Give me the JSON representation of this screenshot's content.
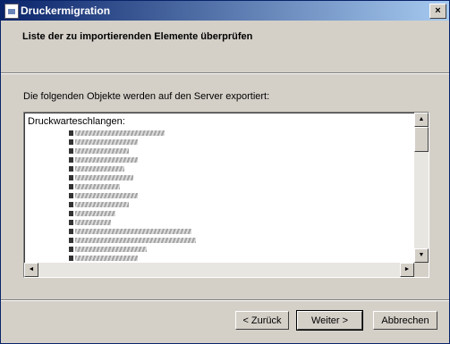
{
  "window": {
    "title": "Druckermigration",
    "close_glyph": "×"
  },
  "header": {
    "title": "Liste der zu importierenden Elemente überprüfen"
  },
  "main": {
    "intro": "Die folgenden Objekte werden auf den Server exportiert:",
    "list_header": "Druckwarteschlangen:",
    "entries_blurred_count": 16
  },
  "scrollbar": {
    "up_glyph": "▲",
    "down_glyph": "▼",
    "left_glyph": "◄",
    "right_glyph": "►"
  },
  "buttons": {
    "back": "< Zurück",
    "next": "Weiter >",
    "cancel": "Abbrechen"
  }
}
